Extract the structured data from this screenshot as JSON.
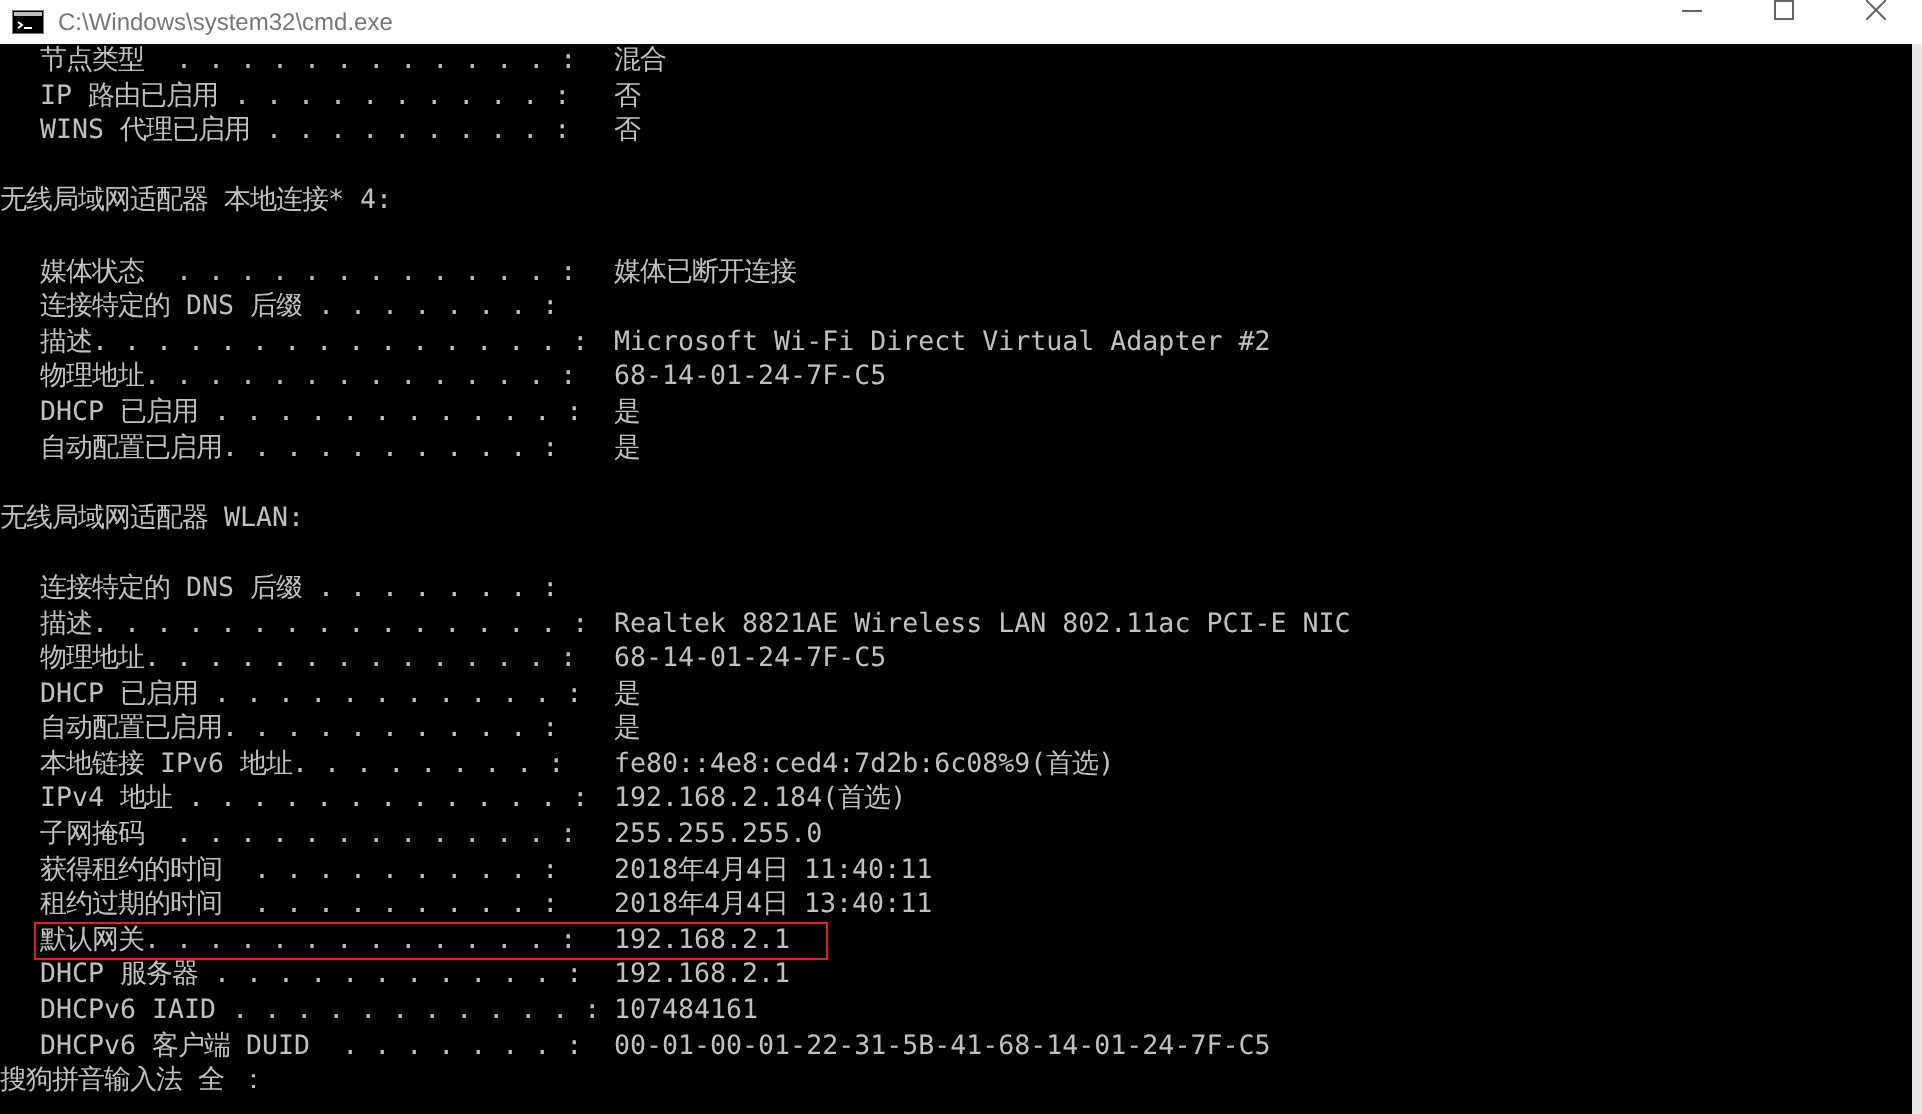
{
  "window": {
    "title": "C:\\Windows\\system32\\cmd.exe"
  },
  "lines": [
    {
      "kind": "field",
      "label": "节点类型  . . . . . . . . . . . . :",
      "value": "混合",
      "highlighted": false
    },
    {
      "kind": "field",
      "label": "IP 路由已启用 . . . . . . . . . . :",
      "value": "否",
      "highlighted": false
    },
    {
      "kind": "field",
      "label": "WINS 代理已启用 . . . . . . . . . :",
      "value": "否",
      "highlighted": false
    },
    {
      "kind": "blank"
    },
    {
      "kind": "header",
      "text": "无线局域网适配器 本地连接* 4:"
    },
    {
      "kind": "blank"
    },
    {
      "kind": "field",
      "label": "媒体状态  . . . . . . . . . . . . :",
      "value": "媒体已断开连接",
      "highlighted": false
    },
    {
      "kind": "field",
      "label": "连接特定的 DNS 后缀 . . . . . . . :",
      "highlighted": false
    },
    {
      "kind": "field",
      "label": "描述. . . . . . . . . . . . . . . :",
      "value": "Microsoft Wi-Fi Direct Virtual Adapter #2",
      "highlighted": false
    },
    {
      "kind": "field",
      "label": "物理地址. . . . . . . . . . . . . :",
      "value": "68-14-01-24-7F-C5",
      "highlighted": false
    },
    {
      "kind": "field",
      "label": "DHCP 已启用 . . . . . . . . . . . :",
      "value": "是",
      "highlighted": false
    },
    {
      "kind": "field",
      "label": "自动配置已启用. . . . . . . . . . :",
      "value": "是",
      "highlighted": false
    },
    {
      "kind": "blank"
    },
    {
      "kind": "header",
      "text": "无线局域网适配器 WLAN:"
    },
    {
      "kind": "blank"
    },
    {
      "kind": "field",
      "label": "连接特定的 DNS 后缀 . . . . . . . :",
      "highlighted": false
    },
    {
      "kind": "field",
      "label": "描述. . . . . . . . . . . . . . . :",
      "value": "Realtek 8821AE Wireless LAN 802.11ac PCI-E NIC",
      "highlighted": false
    },
    {
      "kind": "field",
      "label": "物理地址. . . . . . . . . . . . . :",
      "value": "68-14-01-24-7F-C5",
      "highlighted": false
    },
    {
      "kind": "field",
      "label": "DHCP 已启用 . . . . . . . . . . . :",
      "value": "是",
      "highlighted": false
    },
    {
      "kind": "field",
      "label": "自动配置已启用. . . . . . . . . . :",
      "value": "是",
      "highlighted": false
    },
    {
      "kind": "field",
      "label": "本地链接 IPv6 地址. . . . . . . . :",
      "value": "fe80::4e8:ced4:7d2b:6c08%9(首选)",
      "highlighted": false
    },
    {
      "kind": "field",
      "label": "IPv4 地址 . . . . . . . . . . . . :",
      "value": "192.168.2.184(首选)",
      "highlighted": false
    },
    {
      "kind": "field",
      "label": "子网掩码  . . . . . . . . . . . . :",
      "value": "255.255.255.0",
      "highlighted": false
    },
    {
      "kind": "field",
      "label": "获得租约的时间  . . . . . . . . . :",
      "value": "2018年4月4日 11:40:11",
      "highlighted": false
    },
    {
      "kind": "field",
      "label": "租约过期的时间  . . . . . . . . . :",
      "value": "2018年4月4日 13:40:11",
      "highlighted": false
    },
    {
      "kind": "field",
      "label": "默认网关. . . . . . . . . . . . . :",
      "value": "192.168.2.1",
      "highlighted": true
    },
    {
      "kind": "field",
      "label": "DHCP 服务器 . . . . . . . . . . . :",
      "value": "192.168.2.1",
      "highlighted": false
    },
    {
      "kind": "field",
      "label": "DHCPv6 IAID . . . . . . . . . . . :",
      "value": "107484161",
      "highlighted": false
    },
    {
      "kind": "field",
      "label": "DHCPv6 客户端 DUID  . . . . . . . :",
      "value": "00-01-00-01-22-31-5B-41-68-14-01-24-7F-C5",
      "highlighted": false
    }
  ],
  "ime_status": "搜狗拼音输入法 全 ："
}
